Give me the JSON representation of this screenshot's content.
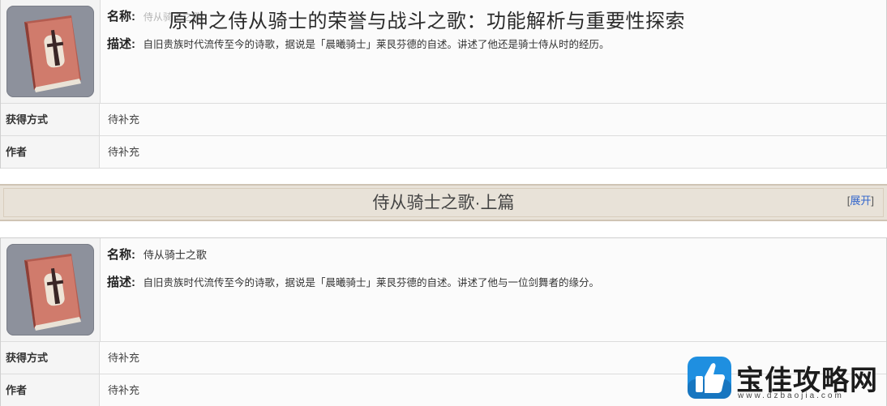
{
  "page": {
    "overlay_title": "原神之侍从骑士的荣誉与战斗之歌：功能解析与重要性探索"
  },
  "item_top": {
    "name_label": "名称:",
    "name_value": "侍从骑士之歌",
    "desc_label": "描述:",
    "desc_value": "自旧贵族时代流传至今的诗歌，据说是「晨曦骑士」莱艮芬德的自述。讲述了他还是骑士侍从时的经历。",
    "rows": [
      {
        "key": "获得方式",
        "value": "待补充"
      },
      {
        "key": "作者",
        "value": "待补充"
      }
    ]
  },
  "section": {
    "title": "侍从骑士之歌·上篇",
    "expand_left": "[",
    "expand_label": "展开",
    "expand_right": "]"
  },
  "item_bottom": {
    "name_label": "名称:",
    "name_value": "侍从骑士之歌",
    "desc_label": "描述:",
    "desc_value": "自旧贵族时代流传至今的诗歌，据说是「晨曦骑士」莱艮芬德的自述。讲述了他与一位剑舞者的缘分。",
    "rows": [
      {
        "key": "获得方式",
        "value": "待补充"
      },
      {
        "key": "作者",
        "value": "待补充"
      }
    ]
  },
  "watermark": {
    "name": "宝佳攻略网",
    "url": "www.dzbaojia.com"
  },
  "icons": [
    "book-icon",
    "thumbs-up-logo-icon"
  ],
  "colors": {
    "book_red": "#c96a5e",
    "banner_bg": "#e8e2d8",
    "link_blue": "#3366cc",
    "logo_blue": "#1f8fe0"
  }
}
